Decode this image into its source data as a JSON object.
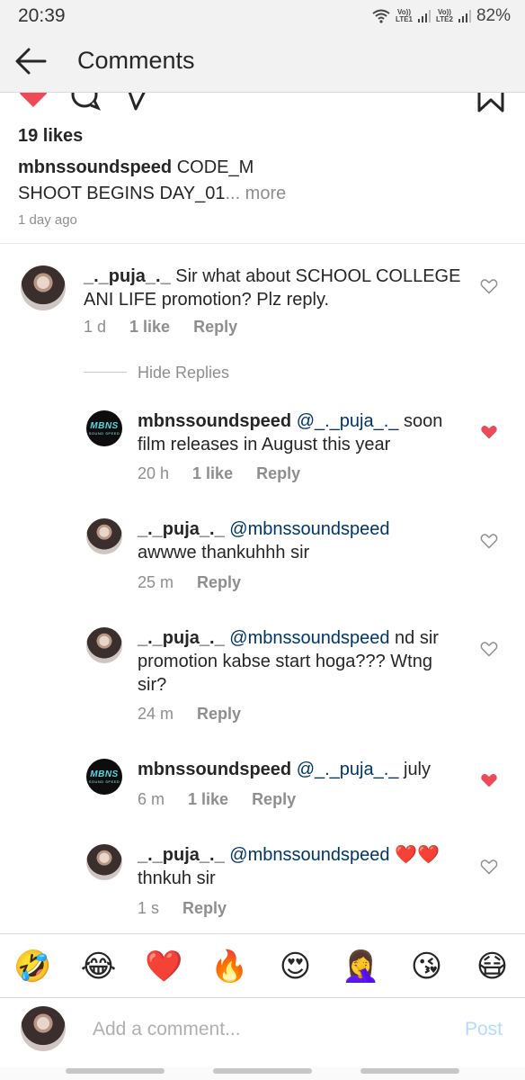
{
  "status_bar": {
    "time": "20:39",
    "sim1_top": "Vo))",
    "sim1_bottom": "LTE1",
    "sim2_top": "Vo))",
    "sim2_bottom": "LTE2",
    "battery": "82%"
  },
  "header": {
    "title": "Comments",
    "back_icon": "arrow-left-icon"
  },
  "post": {
    "likes": "19 likes",
    "caption_user": "mbnssoundspeed",
    "caption_line1": " CODE_M",
    "caption_line2": "SHOOT BEGINS DAY_01",
    "caption_more": "... more",
    "time": "1 day ago"
  },
  "comments": [
    {
      "user": "_._puja_._",
      "mention": "",
      "text": " Sir what about SCHOOL COLLEGE ANI LIFE promotion? Plz reply.",
      "time": "1 d",
      "likes": "1 like",
      "reply": "Reply",
      "liked": false
    }
  ],
  "hide_replies": "Hide Replies",
  "replies": [
    {
      "user": "mbnssoundspeed",
      "mention": "@_._puja_._",
      "text": " soon film releases in August this year",
      "time": "20 h",
      "likes": "1 like",
      "reply": "Reply",
      "liked": true,
      "avatar": "mbns-logo",
      "logo_text": "MBNS",
      "logo_sub": "SOUND SPEED"
    },
    {
      "user": "_._puja_._",
      "mention": "@mbnssoundspeed",
      "text": " awwwe thankuhhh sir",
      "time": "25 m",
      "likes": "",
      "reply": "Reply",
      "liked": false,
      "avatar": "user-photo"
    },
    {
      "user": "_._puja_._",
      "mention": "@mbnssoundspeed",
      "text": " nd sir promotion kabse start hoga??? Wtng sir?",
      "time": "24 m",
      "likes": "",
      "reply": "Reply",
      "liked": false,
      "avatar": "user-photo"
    },
    {
      "user": "mbnssoundspeed",
      "mention": "@_._puja_._",
      "text": " july",
      "time": "6 m",
      "likes": "1 like",
      "reply": "Reply",
      "liked": true,
      "avatar": "mbns-logo",
      "logo_text": "MBNS",
      "logo_sub": "SOUND SPEED"
    },
    {
      "user": "_._puja_._",
      "mention": "@mbnssoundspeed",
      "text": " ❤️❤️ thnkuh sir",
      "time": "1 s",
      "likes": "",
      "reply": "Reply",
      "liked": false,
      "avatar": "user-photo"
    }
  ],
  "emoji_bar": [
    "🤣",
    "😂",
    "❤️",
    "🔥",
    "😍",
    "🤦‍♀️",
    "😘",
    "😷"
  ],
  "input": {
    "placeholder": "Add a comment...",
    "post_label": "Post"
  },
  "colors": {
    "like_red": "#ed4956",
    "mention_blue": "#003569",
    "post_disabled": "#b3dbff"
  }
}
